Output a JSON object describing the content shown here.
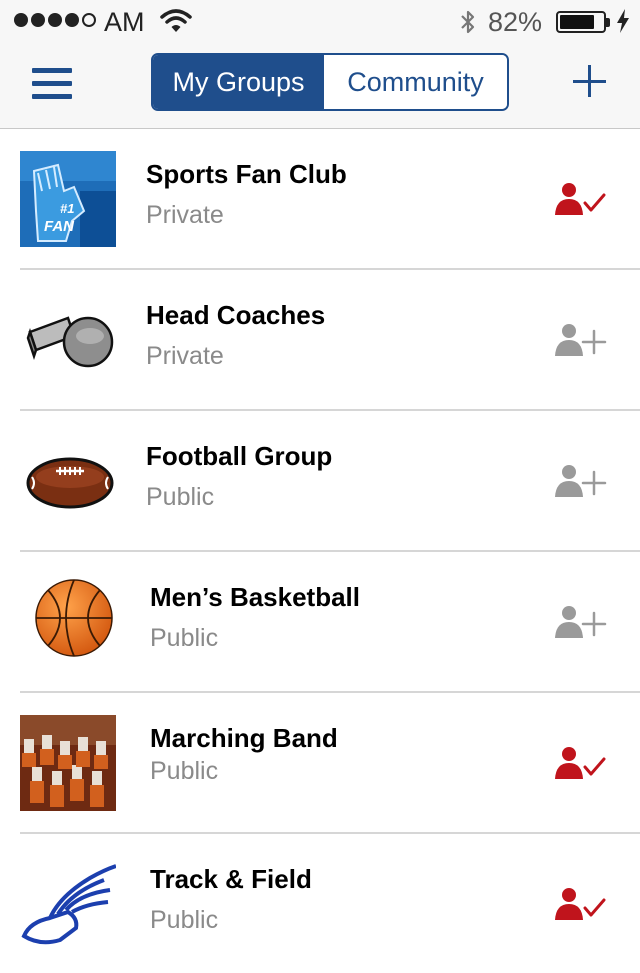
{
  "status_bar": {
    "carrier": "AM",
    "battery_percent": "82%",
    "battery_level": 0.82,
    "signal_bars_filled": 4,
    "signal_bars_total": 5
  },
  "nav": {
    "tabs": [
      {
        "label": "My Groups",
        "active": true
      },
      {
        "label": "Community",
        "active": false
      }
    ],
    "menu_icon": "hamburger-icon",
    "add_icon": "plus-icon"
  },
  "groups": [
    {
      "name": "Sports Fan Club",
      "privacy": "Private",
      "icon": "foam-finger-fan-photo",
      "status": "joined"
    },
    {
      "name": "Head Coaches",
      "privacy": "Private",
      "icon": "whistle-icon",
      "status": "join"
    },
    {
      "name": "Football Group",
      "privacy": "Public",
      "icon": "football-icon",
      "status": "join"
    },
    {
      "name": "Men’s Basketball",
      "privacy": "Public",
      "icon": "basketball-icon",
      "status": "join"
    },
    {
      "name": "Marching Band",
      "privacy": "Public",
      "icon": "marching-band-photo",
      "status": "joined"
    },
    {
      "name": "Track & Field",
      "privacy": "Public",
      "icon": "winged-foot-icon",
      "status": "joined"
    }
  ],
  "colors": {
    "brand_blue": "#1f4e8c",
    "joined_red": "#c0141c",
    "join_gray": "#9a9a9a",
    "secondary_text": "#8a8a8a"
  }
}
